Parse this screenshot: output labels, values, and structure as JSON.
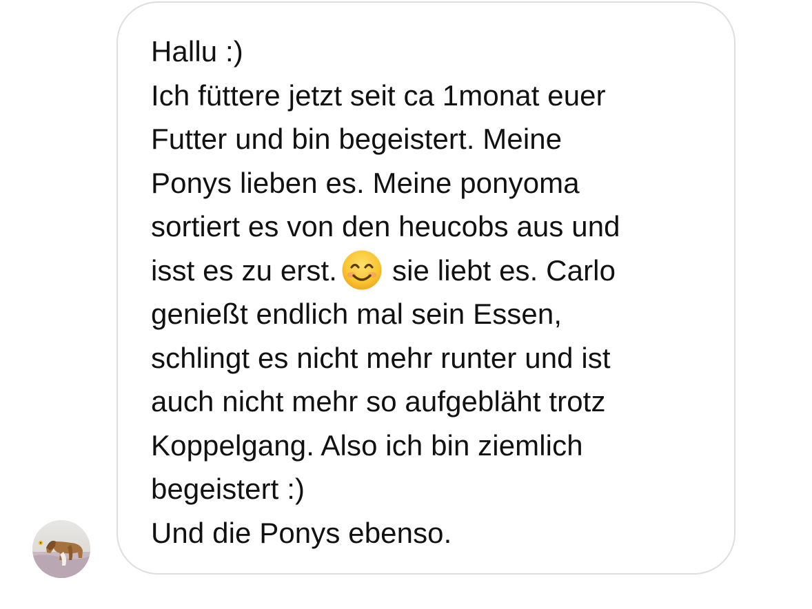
{
  "message": {
    "lines": [
      "Hallu :)",
      "Ich füttere jetzt seit ca 1monat euer",
      "Futter und bin begeistert. Meine",
      "Ponys lieben es. Meine ponyoma",
      "sortiert es von den heucobs aus und",
      "isst es zu erst.",
      "sie liebt es. Carlo",
      "genießt endlich mal sein Essen,",
      "schlingt es nicht mehr runter und ist",
      "auch nicht mehr so aufgebläht trotz",
      "Koppelgang. Also ich bin ziemlich",
      "begeistert :)",
      "Und die Ponys ebenso."
    ],
    "emoji": "smiling-face-with-smiling-eyes-icon"
  },
  "sender": {
    "avatar": "horse-photo-avatar"
  },
  "colors": {
    "bubble_border": "#dedede",
    "text": "#111111",
    "emoji_face": "#f9c531"
  }
}
